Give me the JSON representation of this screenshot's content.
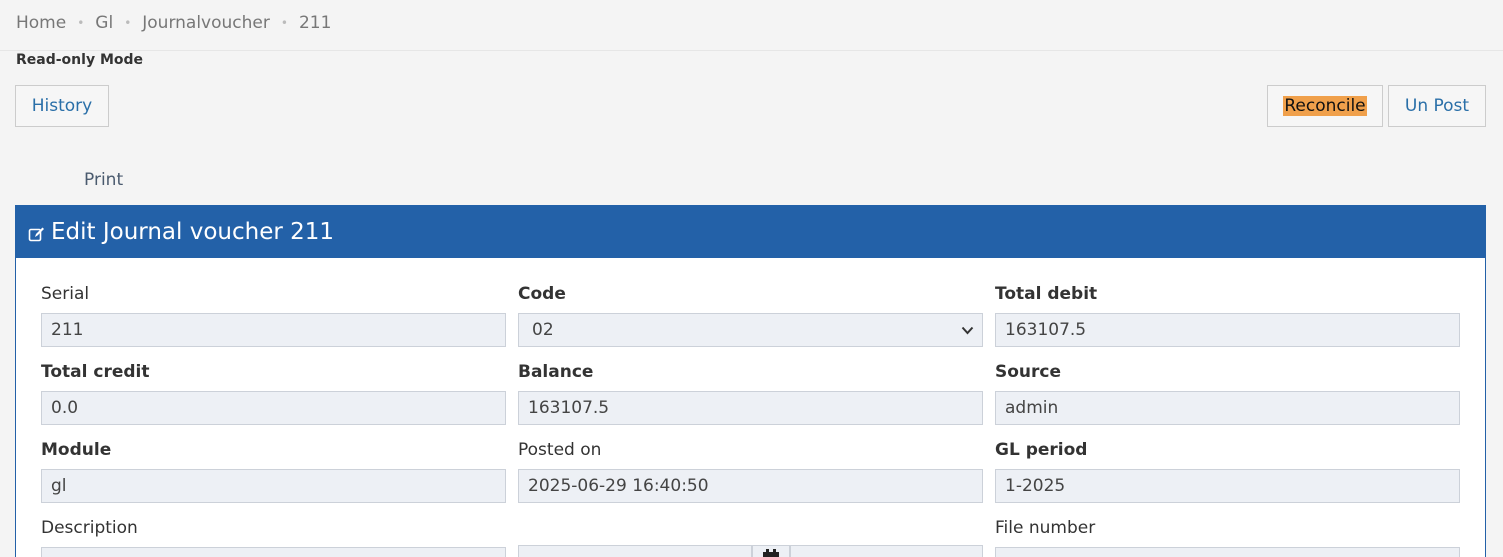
{
  "breadcrumb": [
    "Home",
    "Gl",
    "Journalvoucher",
    "211"
  ],
  "mode_label": "Read-only Mode",
  "buttons": {
    "history": "History",
    "reconcile": "Reconcile",
    "unpost": "Un Post"
  },
  "print_label": "Print",
  "panel": {
    "title": "Edit Journal voucher 211"
  },
  "fields": {
    "serial": {
      "label": "Serial",
      "value": "211"
    },
    "code": {
      "label": "Code",
      "value": "02"
    },
    "total_debit": {
      "label": "Total debit",
      "value": "163107.5"
    },
    "total_credit": {
      "label": "Total credit",
      "value": "0.0"
    },
    "balance": {
      "label": "Balance",
      "value": "163107.5"
    },
    "source": {
      "label": "Source",
      "value": "admin"
    },
    "module": {
      "label": "Module",
      "value": "gl"
    },
    "posted_on": {
      "label": "Posted on",
      "value": "2025-06-29 16:40:50"
    },
    "gl_period": {
      "label": "GL period",
      "value": "1-2025"
    },
    "description": {
      "label": "Description"
    },
    "file_number": {
      "label": "File number"
    }
  },
  "colors": {
    "panel_header": "#2361a8",
    "highlight": "#f0a04b",
    "link": "#2a6fa8"
  },
  "icons": {
    "edit": "edit-icon",
    "calendar": "calendar-icon",
    "select": "chevron-down-icon"
  }
}
